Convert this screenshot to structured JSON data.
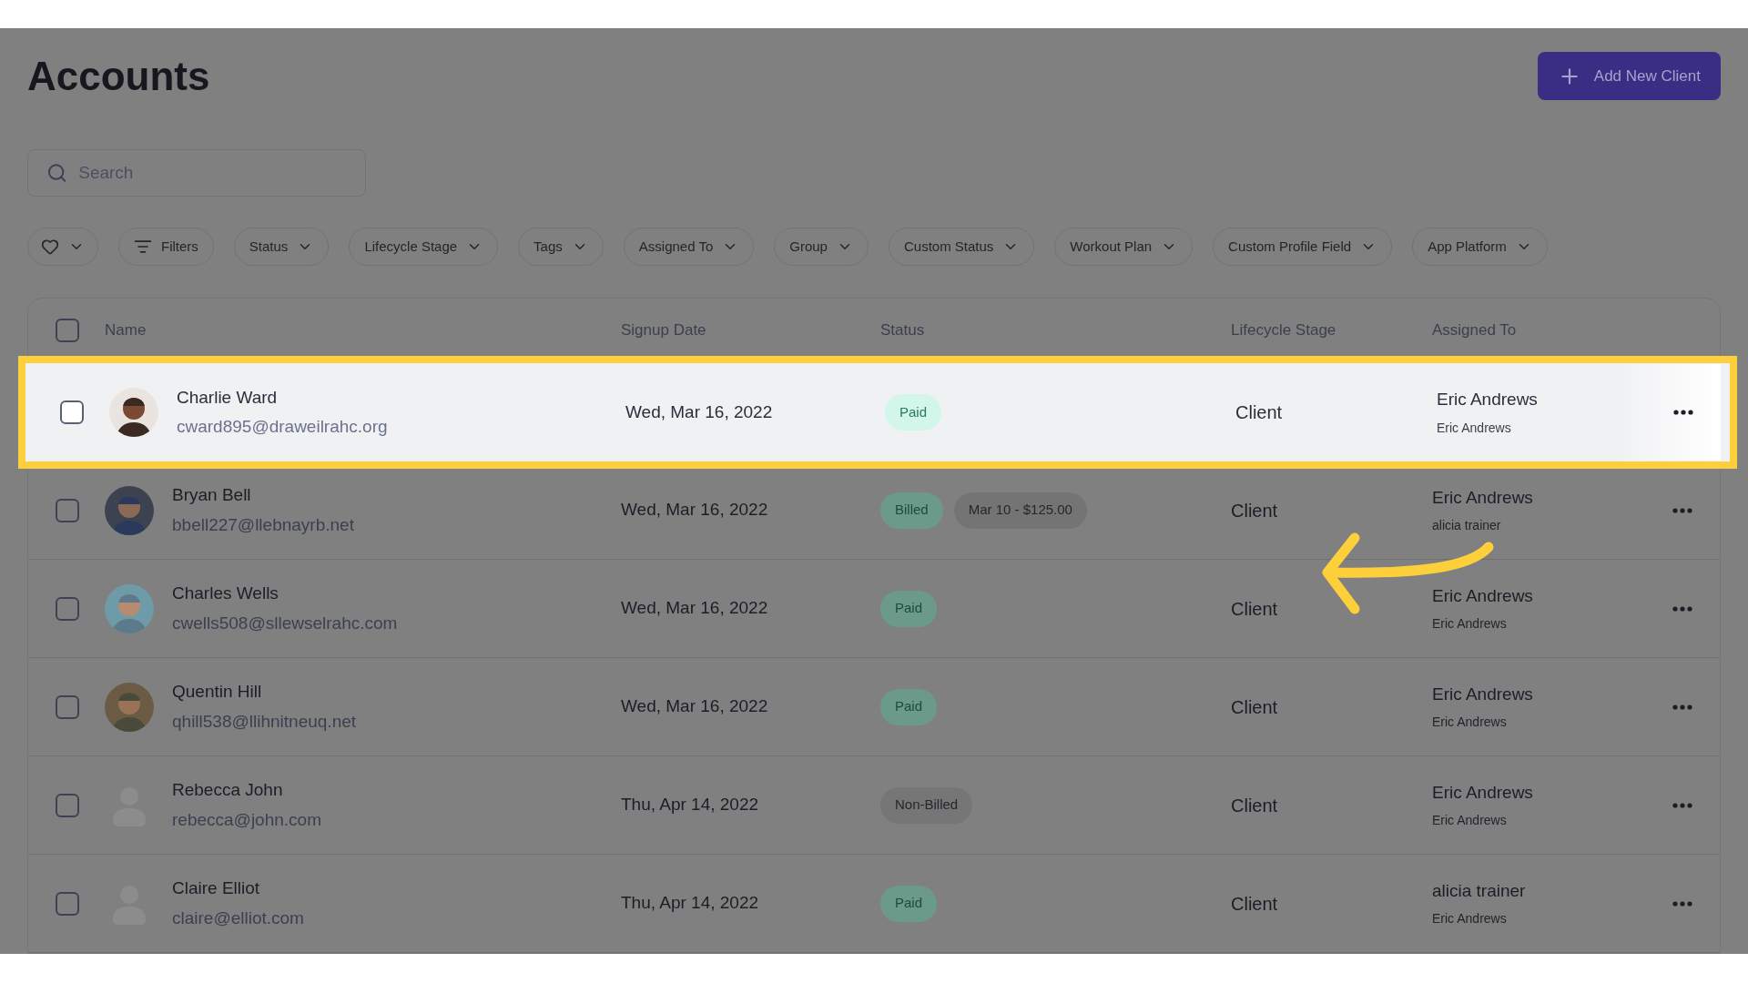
{
  "page": {
    "title": "Accounts",
    "add_button": "Add New Client"
  },
  "search": {
    "placeholder": "Search"
  },
  "filters": [
    {
      "kind": "favorite"
    },
    {
      "kind": "filters",
      "label": "Filters"
    },
    {
      "kind": "dropdown",
      "label": "Status"
    },
    {
      "kind": "dropdown",
      "label": "Lifecycle Stage"
    },
    {
      "kind": "dropdown",
      "label": "Tags"
    },
    {
      "kind": "dropdown",
      "label": "Assigned To"
    },
    {
      "kind": "dropdown",
      "label": "Group"
    },
    {
      "kind": "dropdown",
      "label": "Custom Status"
    },
    {
      "kind": "dropdown",
      "label": "Workout Plan"
    },
    {
      "kind": "dropdown",
      "label": "Custom Profile Field"
    },
    {
      "kind": "dropdown",
      "label": "App Platform"
    }
  ],
  "table": {
    "select_all": {
      "checked": false
    },
    "columns": [
      "Name",
      "Signup Date",
      "Status",
      "Lifecycle Stage",
      "Assigned To"
    ],
    "rows": [
      {
        "highlighted": true,
        "checked": false,
        "name": "Charlie Ward",
        "email": "cward895@draweilrahc.org",
        "signup": "Wed, Mar 16, 2022",
        "status": [
          {
            "kind": "paid",
            "label": "Paid"
          }
        ],
        "stage": "Client",
        "assigned": "Eric Andrews",
        "assigned_sub": "Eric Andrews"
      },
      {
        "highlighted": false,
        "checked": false,
        "name": "Bryan Bell",
        "email": "bbell227@llebnayrb.net",
        "signup": "Wed, Mar 16, 2022",
        "status": [
          {
            "kind": "billed",
            "label": "Billed"
          },
          {
            "kind": "info",
            "label": "Mar 10 - $125.00"
          }
        ],
        "stage": "Client",
        "assigned": "Eric Andrews",
        "assigned_sub": "alicia trainer"
      },
      {
        "highlighted": false,
        "checked": false,
        "name": "Charles Wells",
        "email": "cwells508@sllewselrahc.com",
        "signup": "Wed, Mar 16, 2022",
        "status": [
          {
            "kind": "paid",
            "label": "Paid"
          }
        ],
        "stage": "Client",
        "assigned": "Eric Andrews",
        "assigned_sub": "Eric Andrews"
      },
      {
        "highlighted": false,
        "checked": false,
        "name": "Quentin Hill",
        "email": "qhill538@llihnitneuq.net",
        "signup": "Wed, Mar 16, 2022",
        "status": [
          {
            "kind": "paid",
            "label": "Paid"
          }
        ],
        "stage": "Client",
        "assigned": "Eric Andrews",
        "assigned_sub": "Eric Andrews"
      },
      {
        "highlighted": false,
        "checked": false,
        "kind": "default",
        "name": "Rebecca John",
        "email": "rebecca@john.com",
        "signup": "Thu, Apr 14, 2022",
        "status": [
          {
            "kind": "non_billed",
            "label": "Non-Billed"
          }
        ],
        "stage": "Client",
        "assigned": "Eric Andrews",
        "assigned_sub": "Eric Andrews"
      },
      {
        "highlighted": false,
        "checked": false,
        "kind": "default",
        "name": "Claire Elliot",
        "email": "claire@elliot.com",
        "signup": "Thu, Apr 14, 2022",
        "status": [
          {
            "kind": "paid",
            "label": "Paid"
          }
        ],
        "stage": "Client",
        "assigned": "alicia trainer",
        "assigned_sub": "Eric Andrews"
      }
    ]
  }
}
